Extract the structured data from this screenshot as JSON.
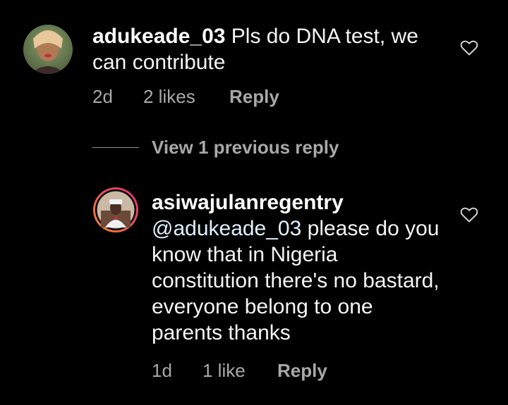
{
  "comments": [
    {
      "username": "adukeade_03",
      "text": " Pls do DNA test, we can contribute",
      "time": "2d",
      "likes": "2 likes",
      "reply_label": "Reply",
      "like_icon": "heart-outline-icon"
    }
  ],
  "view_replies": {
    "label": "View 1 previous reply"
  },
  "replies": [
    {
      "username": "asiwajulanregentry",
      "mention": "@adukeade_03",
      "text": " please do you know that in Nigeria constitution there's no bastard, everyone belong to one parents thanks",
      "time": "1d",
      "likes": "1 like",
      "reply_label": "Reply",
      "like_icon": "heart-outline-icon"
    }
  ],
  "colors": {
    "background": "#000000",
    "text": "#f5f5f5",
    "secondary": "#a8a8a8",
    "mention": "#e0f1ff",
    "story_ring_start": "#f58529",
    "story_ring_end": "#dd2a7b"
  }
}
